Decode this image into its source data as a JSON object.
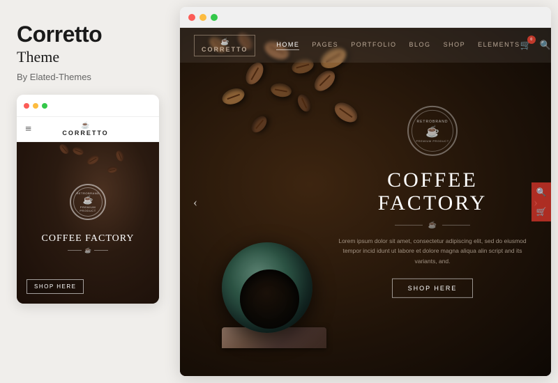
{
  "left": {
    "title": "Corretto",
    "subtitle": "Theme",
    "author": "By Elated-Themes"
  },
  "mobile": {
    "dots": [
      "red",
      "yellow",
      "green"
    ],
    "hamburger": "≡",
    "logo_icon": "☕",
    "logo_text": "CORRETTO",
    "badge_top": "RETROBRAND",
    "badge_icon": "☕",
    "badge_bottom": "PREMIUM PRODUCT",
    "headline": "COFFEE FACTORY",
    "shop_btn": "shop HeRE"
  },
  "desktop": {
    "nav": {
      "logo_icon": "☕",
      "logo_text": "CORRETTO",
      "links": [
        "HOME",
        "PAGES",
        "PORTFOLIO",
        "BLOG",
        "SHOP",
        "ELEMENTS"
      ],
      "active_link": "HOME"
    },
    "badge": {
      "top": "RETROBRAND",
      "icon": "☕",
      "bottom": "PREMIUM PRODUCT"
    },
    "headline": "COFFEE FACTORY",
    "description": "Lorem ipsum dolor sit amet, consectetur adipiscing elit, sed do eiusmod tempor\nincid idunt ut labore et dolore magna aliqua alin script and its variants, and.",
    "shop_btn": "SHOP HERE",
    "arrows": {
      "left": "‹",
      "right": "›"
    }
  }
}
